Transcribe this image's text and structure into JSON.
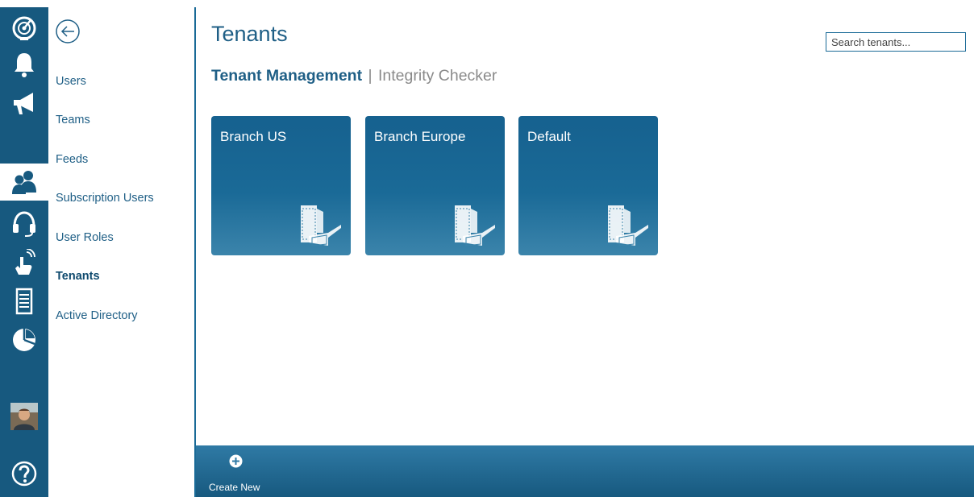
{
  "rail": {
    "items": [
      {
        "icon": "dashboard-gauge-icon"
      },
      {
        "icon": "bell-icon"
      },
      {
        "icon": "megaphone-icon"
      },
      {
        "icon": "users-icon",
        "active": true
      },
      {
        "icon": "headset-icon"
      },
      {
        "icon": "touch-hand-icon"
      },
      {
        "icon": "server-icon"
      },
      {
        "icon": "pie-chart-icon"
      },
      {
        "icon": "user-avatar"
      },
      {
        "icon": "help-icon"
      }
    ]
  },
  "subnav": {
    "items": [
      {
        "label": "Users"
      },
      {
        "label": "Teams"
      },
      {
        "label": "Feeds"
      },
      {
        "label": "Subscription Users"
      },
      {
        "label": "User Roles"
      },
      {
        "label": "Tenants",
        "active": true
      },
      {
        "label": "Active Directory"
      }
    ]
  },
  "main": {
    "title": "Tenants",
    "search_placeholder": "Search tenants...",
    "tabs": {
      "active": "Tenant Management",
      "separator": "|",
      "other": "Integrity Checker"
    },
    "tiles": [
      {
        "label": "Branch US",
        "icon": "building-icon"
      },
      {
        "label": "Branch Europe",
        "icon": "building-icon"
      },
      {
        "label": "Default",
        "icon": "building-icon"
      }
    ]
  },
  "bottombar": {
    "create_label": "Create New",
    "create_icon": "plus-circle-icon"
  },
  "colors": {
    "rail": "#17597f",
    "accent": "#1f5f86",
    "tile": "#1a6a97",
    "muted_text": "#8a8a8a"
  }
}
